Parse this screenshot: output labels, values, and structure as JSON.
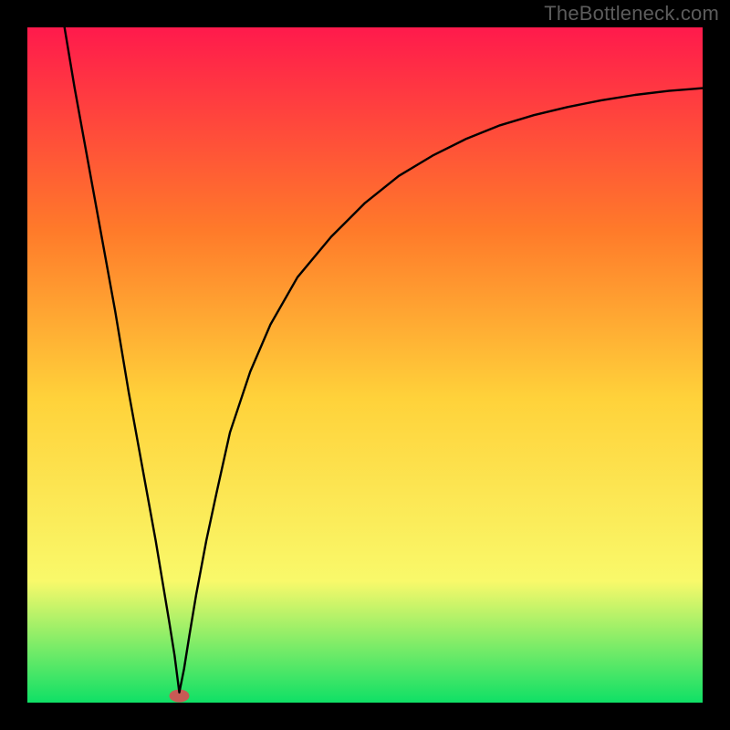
{
  "watermark": "TheBottleneck.com",
  "chart_data": {
    "type": "line",
    "title": "",
    "xlabel": "",
    "ylabel": "",
    "xlim": [
      0,
      100
    ],
    "ylim": [
      0,
      100
    ],
    "grid": false,
    "background_gradient": {
      "top": "#ff1a4c",
      "mid_upper": "#ff7a2a",
      "mid": "#ffd23a",
      "mid_lower": "#f9f96a",
      "bottom": "#0fe066"
    },
    "marker": {
      "x": 22.5,
      "y": 1.0,
      "color": "#c85a55",
      "shape": "pill"
    },
    "series": [
      {
        "name": "curve",
        "color": "#000000",
        "x": [
          5.5,
          7,
          9,
          11,
          13,
          15,
          17,
          19,
          21,
          21.8,
          22.5,
          23.2,
          24,
          25,
          26.5,
          28,
          30,
          33,
          36,
          40,
          45,
          50,
          55,
          60,
          65,
          70,
          75,
          80,
          85,
          90,
          95,
          100
        ],
        "values": [
          100,
          91,
          80,
          69,
          58,
          46,
          35,
          24,
          12,
          7,
          1.5,
          5,
          10,
          16,
          24,
          31,
          40,
          49,
          56,
          63,
          69,
          74,
          78,
          81,
          83.5,
          85.5,
          87,
          88.2,
          89.2,
          90,
          90.6,
          91
        ]
      }
    ]
  }
}
